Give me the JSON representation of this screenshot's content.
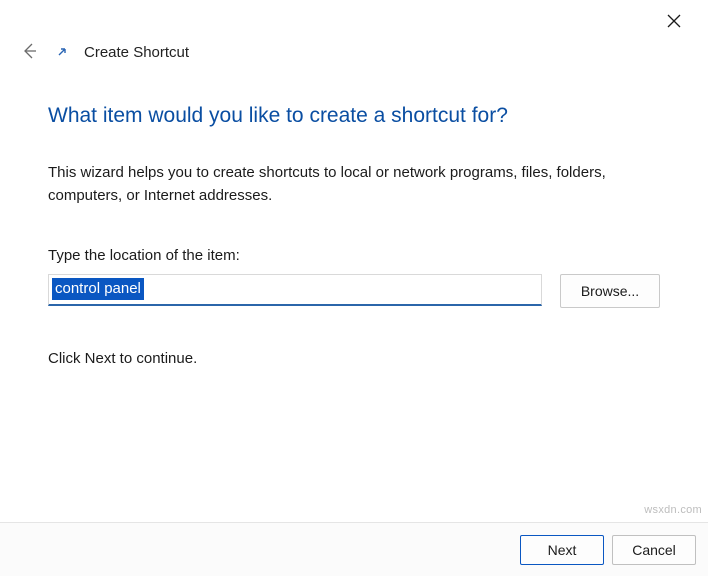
{
  "window": {
    "title": "Create Shortcut"
  },
  "content": {
    "heading": "What item would you like to create a shortcut for?",
    "description": "This wizard helps you to create shortcuts to local or network programs, files, folders, computers, or Internet addresses.",
    "field_label": "Type the location of the item:",
    "location_value": "control panel",
    "browse_label": "Browse...",
    "hint": "Click Next to continue."
  },
  "footer": {
    "next_label": "Next",
    "cancel_label": "Cancel"
  },
  "watermark": "wsxdn.com"
}
